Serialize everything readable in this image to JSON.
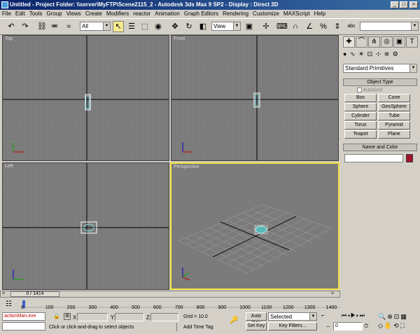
{
  "titlebar": {
    "title": "Untitled    - Project Folder: \\\\server\\MyFTP\\Scene2115_2    - Autodesk 3ds Max 9 SP2    - Display : Direct 3D"
  },
  "menubar": {
    "items": [
      "File",
      "Edit",
      "Tools",
      "Group",
      "Views",
      "Create",
      "Modifiers",
      "reactor",
      "Animation",
      "Graph Editors",
      "Rendering",
      "Customize",
      "MAXScript",
      "Help"
    ]
  },
  "toolbar": {
    "selection_filter": "All",
    "coord_system": "View"
  },
  "viewports": {
    "top": "Top",
    "front": "Front",
    "left": "Left",
    "perspective": "Perspective"
  },
  "command_panel": {
    "category": "Standard Primitives",
    "object_type_title": "Object Type",
    "autogrid_label": "AutoGrid",
    "object_buttons": [
      "Box",
      "Cone",
      "Sphere",
      "GeoSphere",
      "Cylinder",
      "Tube",
      "Torus",
      "Pyramid",
      "Teapot",
      "Plane"
    ],
    "name_color_title": "Name and Color",
    "object_color": "#a0102a"
  },
  "timeline": {
    "frame_readout": "0 / 1414",
    "ticks": [
      "100",
      "200",
      "300",
      "400",
      "500",
      "600",
      "700",
      "800",
      "900",
      "1000",
      "1100",
      "1200",
      "1300",
      "1400"
    ],
    "tick_start": "0"
  },
  "statusbar": {
    "listener": "actionMan.exe",
    "prompt": "Click or click-and-drag to select objects",
    "x_label": "X:",
    "y_label": "Y:",
    "z_label": "Z:",
    "grid": "Grid = 10.0",
    "add_time_tag": "Add Time Tag",
    "auto_key": "Auto Key",
    "set_key": "Set Key",
    "key_mode": "Selected",
    "key_filters": "Key Filters...",
    "current_frame": "0"
  }
}
